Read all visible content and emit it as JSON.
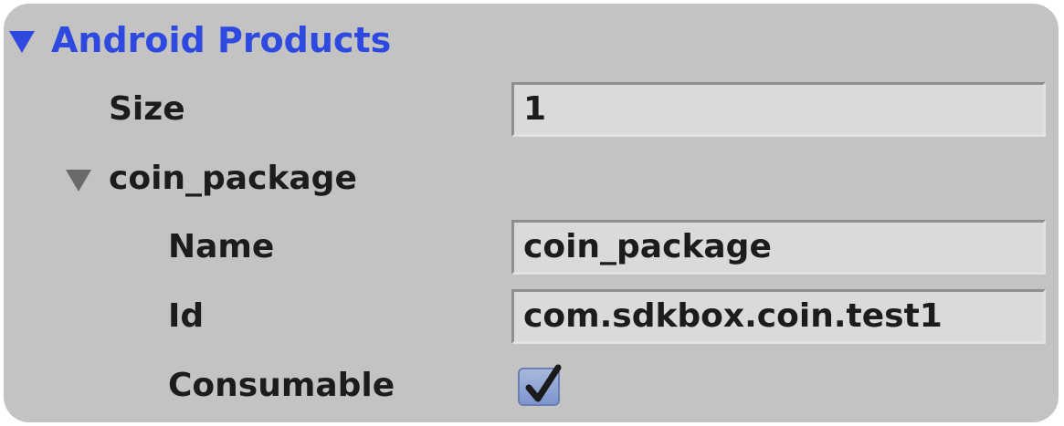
{
  "section": {
    "title": "Android Products",
    "expanded": true
  },
  "size": {
    "label": "Size",
    "value": "1"
  },
  "item": {
    "title": "coin_package",
    "expanded": true,
    "name": {
      "label": "Name",
      "value": "coin_package"
    },
    "id": {
      "label": "Id",
      "value": "com.sdkbox.coin.test1"
    },
    "consumable": {
      "label": "Consumable",
      "checked": true
    }
  },
  "colors": {
    "accent": "#2d49e0",
    "panel": "#c3c3c3",
    "field": "#dadada"
  },
  "icons": {
    "section_toggle": "disclosure-triangle-down-icon",
    "item_toggle": "disclosure-triangle-down-icon",
    "check": "checkmark-icon"
  }
}
